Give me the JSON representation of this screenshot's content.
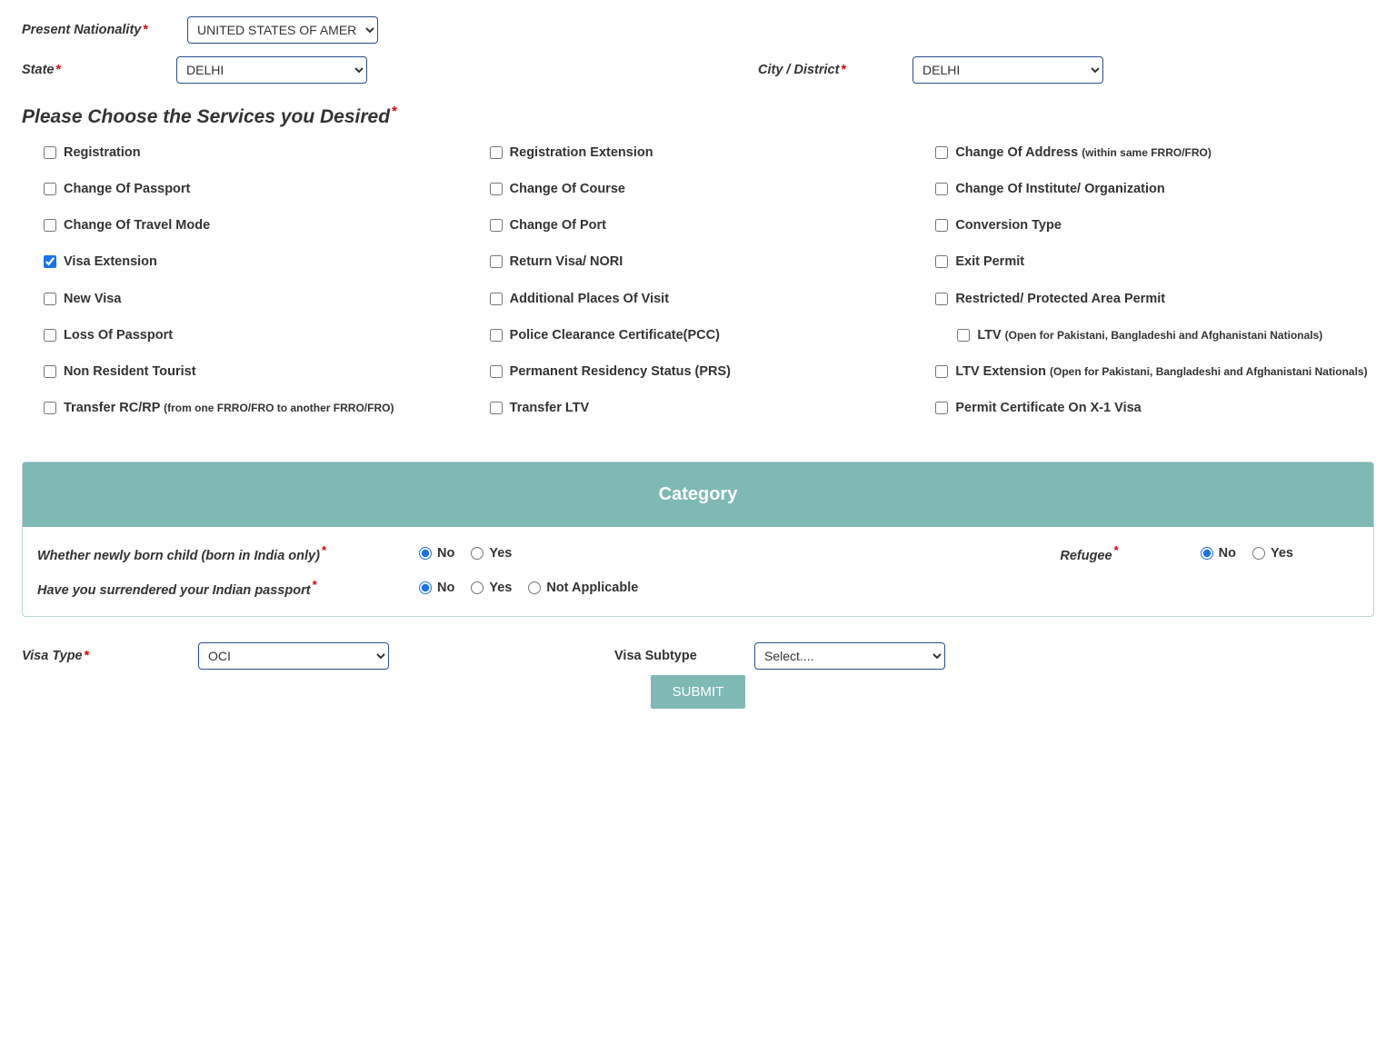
{
  "top": {
    "nationality_label": "Present Nationality",
    "nationality_value": "UNITED STATES OF AMERICA",
    "state_label": "State",
    "state_value": "DELHI",
    "city_label": "City / District",
    "city_value": "DELHI"
  },
  "services": {
    "heading": "Please Choose the Services you Desired",
    "items": {
      "registration": "Registration",
      "reg_ext": "Registration Extension",
      "coa": "Change Of Address ",
      "coa_sub": "(within same FRRO/FRO)",
      "cop": "Change Of Passport",
      "coc": "Change Of Course",
      "coi": "Change Of Institute/ Organization",
      "cotm": "Change Of Travel Mode",
      "coport": "Change Of Port",
      "conv": "Conversion Type",
      "visa_ext": "Visa Extension",
      "return_nori": "Return Visa/ NORI",
      "exit_permit": "Exit Permit",
      "new_visa": "New Visa",
      "apov": "Additional Places Of Visit",
      "rap": "Restricted/ Protected Area Permit",
      "lop": "Loss Of Passport",
      "pcc": "Police Clearance Certificate(PCC)",
      "ltv": "LTV ",
      "ltv_sub": "(Open for Pakistani, Bangladeshi and Afghanistani Nationals)",
      "nrt": "Non Resident Tourist",
      "prs": "Permanent Residency Status (PRS)",
      "ltv_ext": "LTV Extension ",
      "ltv_ext_sub": "(Open for Pakistani, Bangladeshi and Afghanistani Nationals)",
      "transfer_rc": "Transfer RC/RP ",
      "transfer_rc_sub": "(from one FRRO/FRO to another FRRO/FRO)",
      "transfer_ltv": "Transfer LTV",
      "pcx": "Permit Certificate On X-1 Visa"
    }
  },
  "category": {
    "header": "Category",
    "q1": "Whether newly born child  (born in India only)",
    "q2": "Refugee",
    "q3": "Have you surrendered your Indian passport",
    "opts": {
      "no": "No",
      "yes": "Yes",
      "na": "Not Applicable"
    }
  },
  "visa": {
    "type_label": "Visa Type",
    "type_value": "OCI",
    "subtype_label": "Visa Subtype",
    "subtype_placeholder": "Select...."
  },
  "submit_label": "SUBMIT"
}
